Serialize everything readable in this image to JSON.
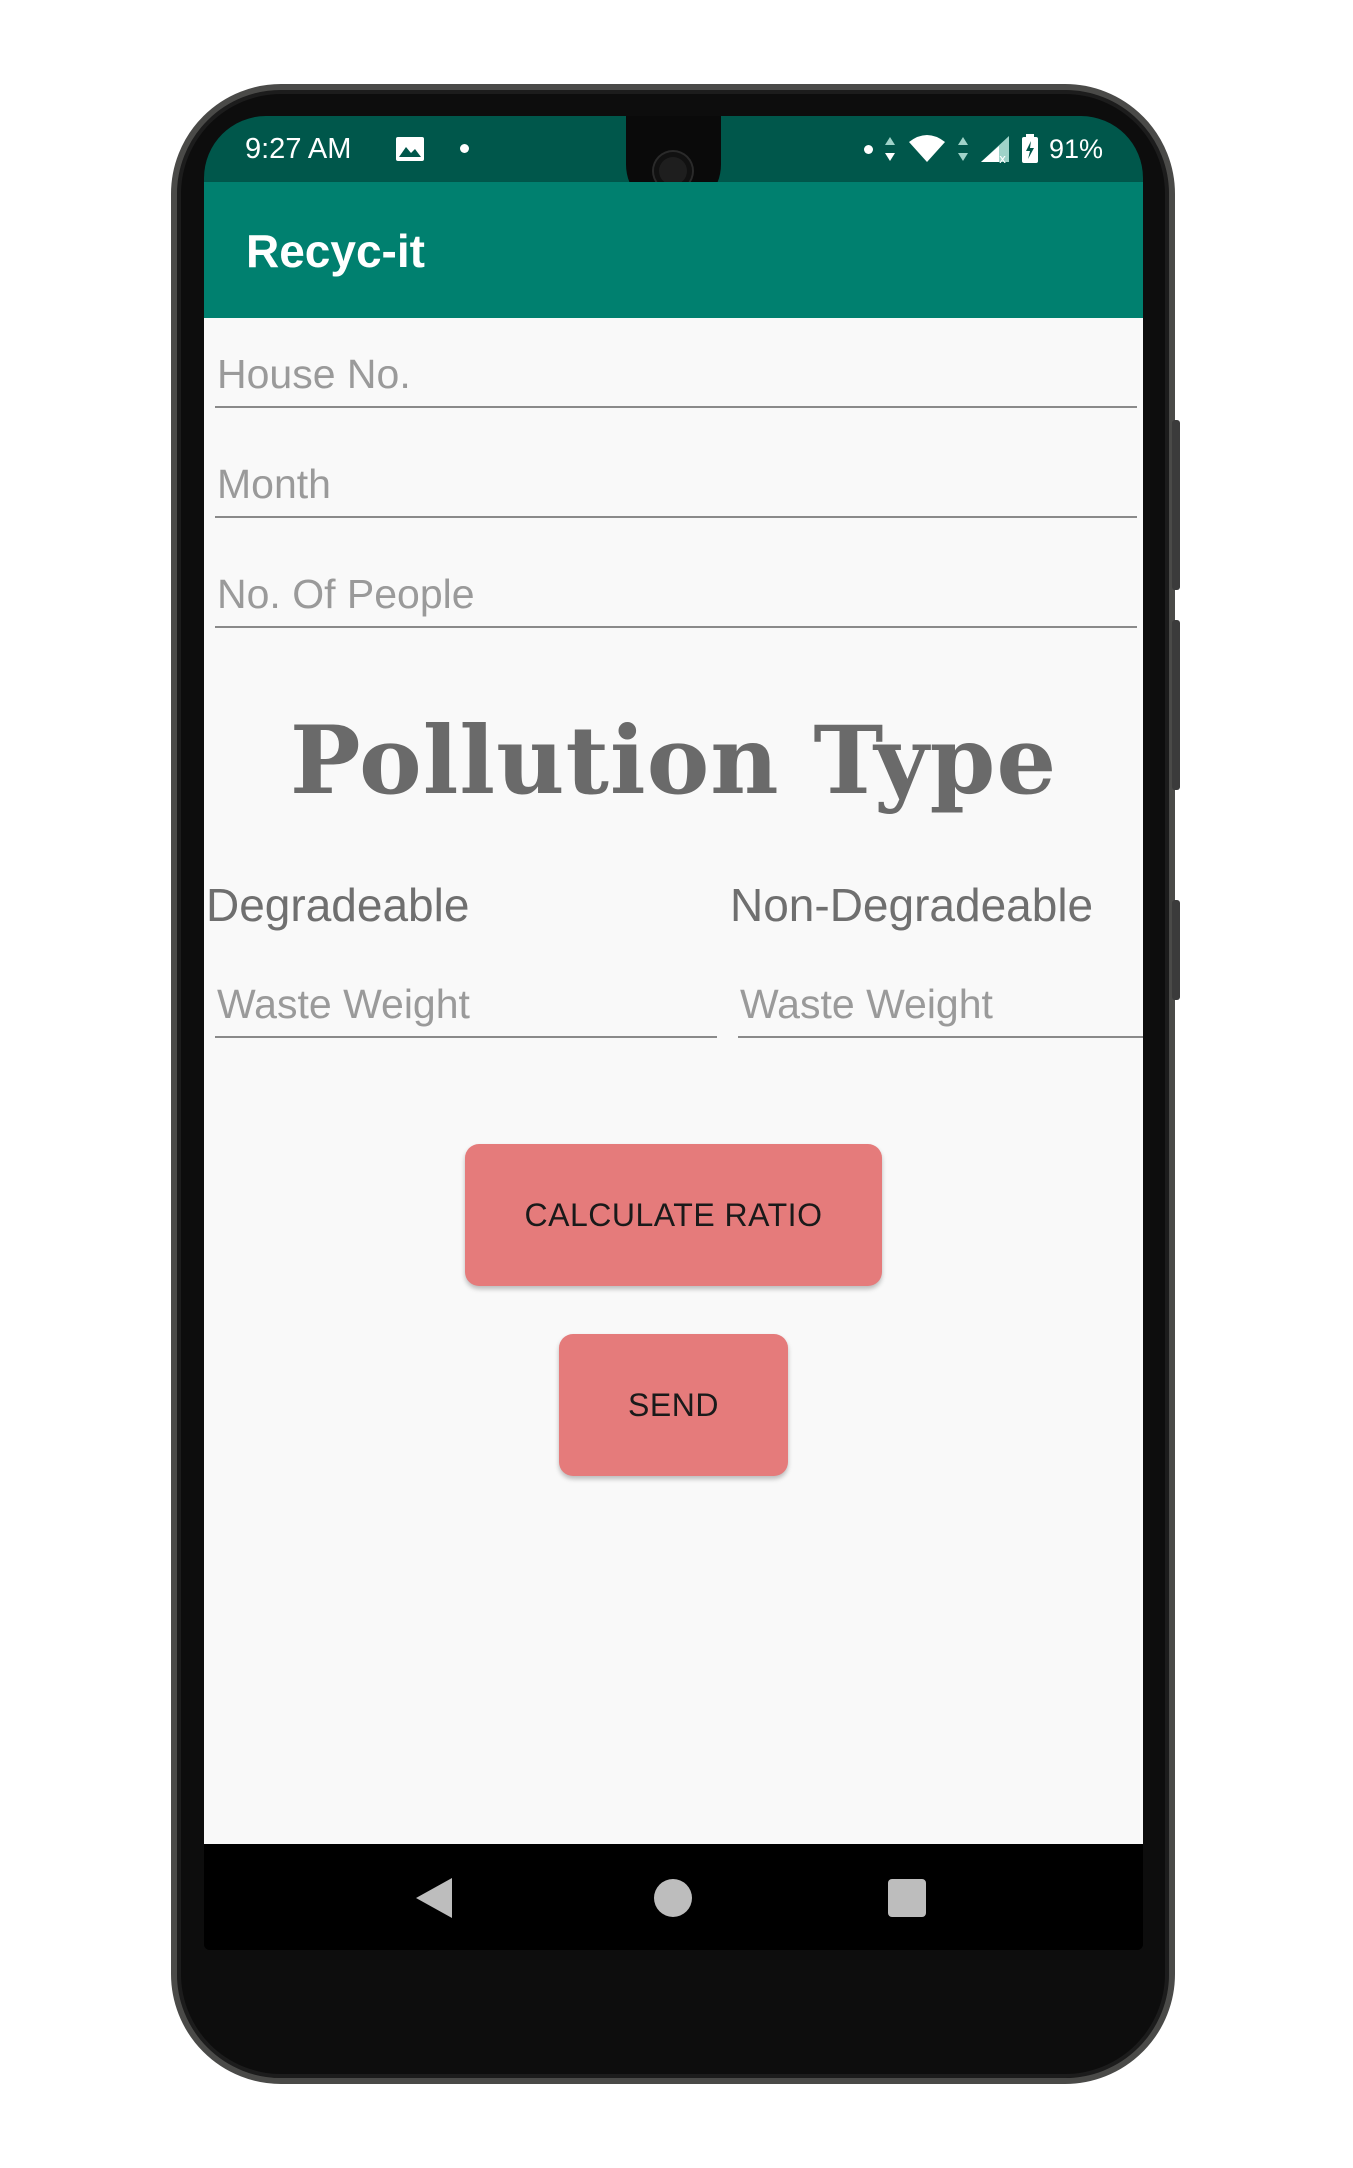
{
  "status_bar": {
    "time": "9:27 AM",
    "battery": "91%",
    "icons": [
      "image-icon",
      "dot-icon",
      "dot-icon",
      "data-arrows-icon",
      "wifi-icon",
      "signal-icon",
      "battery-charging-icon"
    ]
  },
  "app_bar": {
    "title": "Recyc-it",
    "color": "#00806f",
    "status_color": "#00574b"
  },
  "form": {
    "house_no_placeholder": "House No.",
    "month_placeholder": "Month",
    "people_placeholder": "No. Of People"
  },
  "pollution": {
    "title": "Pollution Type",
    "degradable_label": "Degradeable",
    "non_degradable_label": "Non-Degradeable",
    "degradable_weight_placeholder": "Waste Weight",
    "non_degradable_weight_placeholder": "Waste Weight"
  },
  "buttons": {
    "calculate_label": "CALCULATE RATIO",
    "send_label": "SEND",
    "color": "#e57b7b"
  },
  "nav_bar": {
    "icons": [
      "back-icon",
      "home-icon",
      "recents-icon"
    ]
  }
}
